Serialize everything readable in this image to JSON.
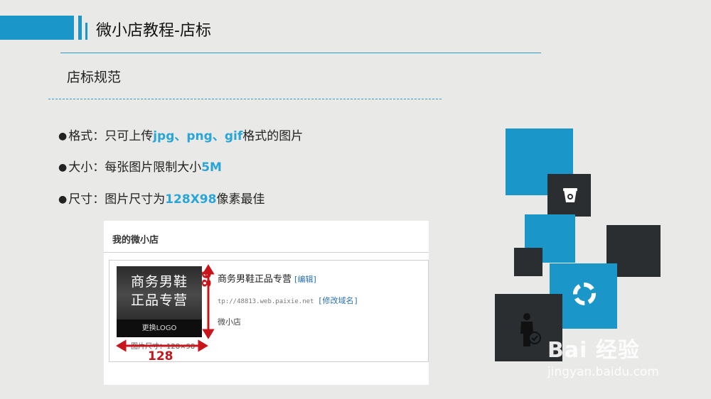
{
  "header": {
    "title": "微小店教程-店标",
    "subtitle": "店标规范"
  },
  "bullets": [
    {
      "parts": [
        {
          "text": "格式：只可上传",
          "hl": false
        },
        {
          "text": "jpg、png、gif",
          "hl": true
        },
        {
          "text": "格式的图片",
          "hl": false
        }
      ]
    },
    {
      "parts": [
        {
          "text": "大小：每张图片限制大小",
          "hl": false
        },
        {
          "text": "5M",
          "hl": true
        }
      ]
    },
    {
      "parts": [
        {
          "text": "尺寸：图片尺寸为",
          "hl": false
        },
        {
          "text": "128X98",
          "hl": true
        },
        {
          "text": "像素最佳",
          "hl": false
        }
      ]
    }
  ],
  "bullet_symbol": "●",
  "screenshot": {
    "heading": "我的微小店",
    "logo_line1": "商务男鞋",
    "logo_line2": "正品专营",
    "logo_change": "更换LOGO",
    "size_note": "图片尺寸：128×98",
    "shop_name": "商务男鞋正品专营",
    "edit_link": "[编辑]",
    "shop_url": "tp://48813.web.paixie.net",
    "modify_domain": "[修改域名]",
    "shop_sub": "微小店",
    "dim_height": "98",
    "dim_width": "128"
  },
  "colors": {
    "accent": "#1a96c9",
    "dark_tile": "#2b2e31",
    "annotation_red": "#c8141b"
  },
  "icons": [
    "bucket-icon",
    "refresh-circle-icon",
    "person-check-icon"
  ],
  "watermark": {
    "brand": "Bai 经验",
    "url": "jingyan.baidu.com"
  }
}
